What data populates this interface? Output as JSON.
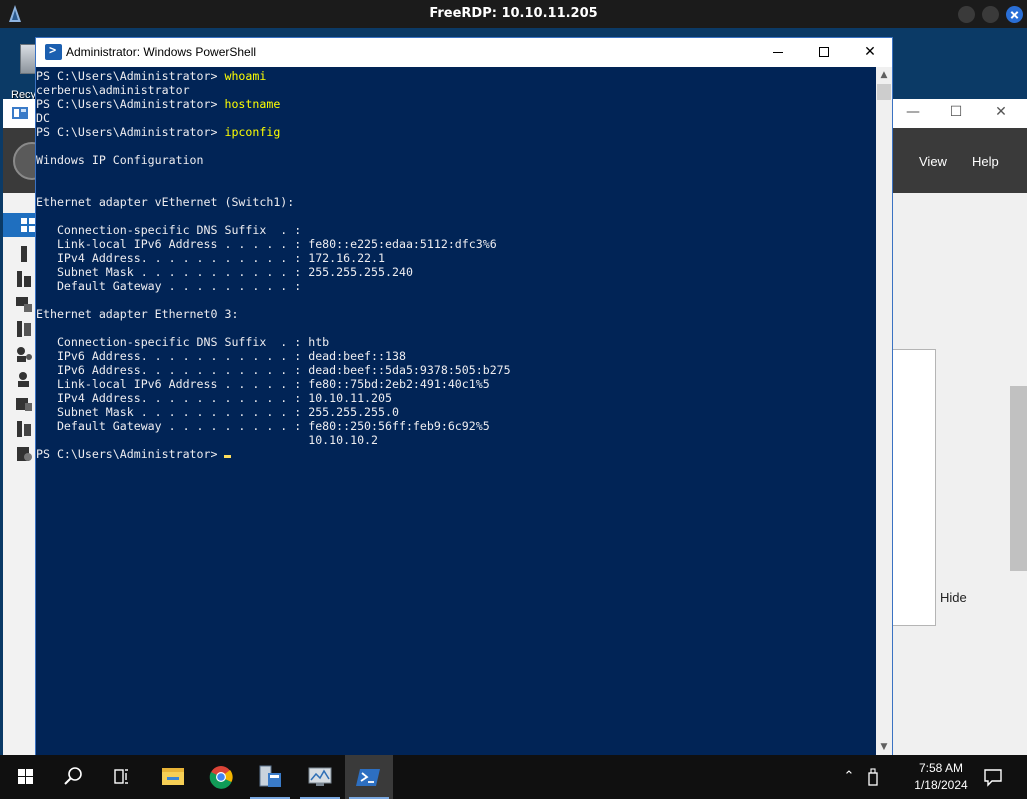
{
  "rdp": {
    "title": "FreeRDP: 10.10.11.205"
  },
  "desktop": {
    "recycle_bin_label": "Recy"
  },
  "server_manager": {
    "menu_view": "View",
    "menu_help": "Help",
    "hide_label": "Hide"
  },
  "powershell": {
    "title": "Administrator: Windows PowerShell",
    "prompt": "PS C:\\Users\\Administrator> ",
    "lines": [
      {
        "prompt": "PS C:\\Users\\Administrator> ",
        "cmd": "whoami"
      },
      {
        "out": "cerberus\\administrator"
      },
      {
        "prompt": "PS C:\\Users\\Administrator> ",
        "cmd": "hostname"
      },
      {
        "out": "DC"
      },
      {
        "prompt": "PS C:\\Users\\Administrator> ",
        "cmd": "ipconfig"
      },
      {
        "out": ""
      },
      {
        "out": "Windows IP Configuration"
      },
      {
        "out": ""
      },
      {
        "out": ""
      },
      {
        "out": "Ethernet adapter vEthernet (Switch1):"
      },
      {
        "out": ""
      },
      {
        "out": "   Connection-specific DNS Suffix  . :"
      },
      {
        "out": "   Link-local IPv6 Address . . . . . : fe80::e225:edaa:5112:dfc3%6"
      },
      {
        "out": "   IPv4 Address. . . . . . . . . . . : 172.16.22.1"
      },
      {
        "out": "   Subnet Mask . . . . . . . . . . . : 255.255.255.240"
      },
      {
        "out": "   Default Gateway . . . . . . . . . :"
      },
      {
        "out": ""
      },
      {
        "out": "Ethernet adapter Ethernet0 3:"
      },
      {
        "out": ""
      },
      {
        "out": "   Connection-specific DNS Suffix  . : htb"
      },
      {
        "out": "   IPv6 Address. . . . . . . . . . . : dead:beef::138"
      },
      {
        "out": "   IPv6 Address. . . . . . . . . . . : dead:beef::5da5:9378:505:b275"
      },
      {
        "out": "   Link-local IPv6 Address . . . . . : fe80::75bd:2eb2:491:40c1%5"
      },
      {
        "out": "   IPv4 Address. . . . . . . . . . . : 10.10.11.205"
      },
      {
        "out": "   Subnet Mask . . . . . . . . . . . : 255.255.255.0"
      },
      {
        "out": "   Default Gateway . . . . . . . . . : fe80::250:56ff:feb9:6c92%5"
      },
      {
        "out": "                                       10.10.10.2"
      },
      {
        "prompt": "PS C:\\Users\\Administrator> ",
        "cmd": "",
        "cursor": true
      }
    ],
    "colors": {
      "background": "#012456",
      "text": "#eeedf0",
      "command": "#ffff00"
    }
  },
  "taskbar": {
    "time": "7:58 AM",
    "date": "1/18/2024",
    "items": [
      {
        "icon": "windows-start-icon"
      },
      {
        "icon": "search-icon"
      },
      {
        "icon": "task-view-icon"
      },
      {
        "icon": "file-explorer-icon"
      },
      {
        "icon": "chrome-icon"
      },
      {
        "icon": "server-manager-icon"
      },
      {
        "icon": "remote-desktop-icon"
      },
      {
        "icon": "powershell-icon"
      }
    ]
  }
}
